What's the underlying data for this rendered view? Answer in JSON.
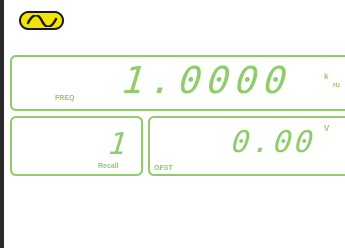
{
  "waveform": {
    "icon": "sine-wave-icon",
    "color": "#f2e600"
  },
  "freq": {
    "value": "1.0000",
    "unit_prefix": "k",
    "unit": "Hz",
    "label": "FREQ"
  },
  "recall": {
    "value": "1",
    "label": "Recall"
  },
  "offset": {
    "value": "0.00",
    "unit": "V",
    "label": "OFST"
  },
  "colors": {
    "accent": "#8fcc6a",
    "badge": "#f2e600",
    "text_dark": "#1a1a1a"
  }
}
